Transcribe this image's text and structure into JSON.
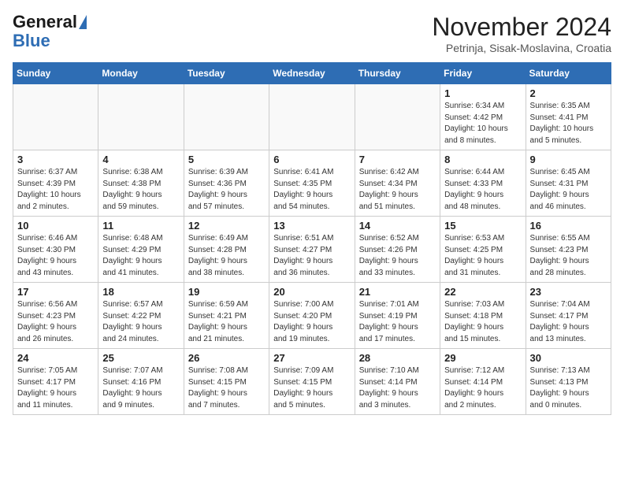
{
  "header": {
    "logo_line1": "General",
    "logo_line2": "Blue",
    "month": "November 2024",
    "location": "Petrinja, Sisak-Moslavina, Croatia"
  },
  "weekdays": [
    "Sunday",
    "Monday",
    "Tuesday",
    "Wednesday",
    "Thursday",
    "Friday",
    "Saturday"
  ],
  "weeks": [
    [
      {
        "day": "",
        "info": ""
      },
      {
        "day": "",
        "info": ""
      },
      {
        "day": "",
        "info": ""
      },
      {
        "day": "",
        "info": ""
      },
      {
        "day": "",
        "info": ""
      },
      {
        "day": "1",
        "info": "Sunrise: 6:34 AM\nSunset: 4:42 PM\nDaylight: 10 hours\nand 8 minutes."
      },
      {
        "day": "2",
        "info": "Sunrise: 6:35 AM\nSunset: 4:41 PM\nDaylight: 10 hours\nand 5 minutes."
      }
    ],
    [
      {
        "day": "3",
        "info": "Sunrise: 6:37 AM\nSunset: 4:39 PM\nDaylight: 10 hours\nand 2 minutes."
      },
      {
        "day": "4",
        "info": "Sunrise: 6:38 AM\nSunset: 4:38 PM\nDaylight: 9 hours\nand 59 minutes."
      },
      {
        "day": "5",
        "info": "Sunrise: 6:39 AM\nSunset: 4:36 PM\nDaylight: 9 hours\nand 57 minutes."
      },
      {
        "day": "6",
        "info": "Sunrise: 6:41 AM\nSunset: 4:35 PM\nDaylight: 9 hours\nand 54 minutes."
      },
      {
        "day": "7",
        "info": "Sunrise: 6:42 AM\nSunset: 4:34 PM\nDaylight: 9 hours\nand 51 minutes."
      },
      {
        "day": "8",
        "info": "Sunrise: 6:44 AM\nSunset: 4:33 PM\nDaylight: 9 hours\nand 48 minutes."
      },
      {
        "day": "9",
        "info": "Sunrise: 6:45 AM\nSunset: 4:31 PM\nDaylight: 9 hours\nand 46 minutes."
      }
    ],
    [
      {
        "day": "10",
        "info": "Sunrise: 6:46 AM\nSunset: 4:30 PM\nDaylight: 9 hours\nand 43 minutes."
      },
      {
        "day": "11",
        "info": "Sunrise: 6:48 AM\nSunset: 4:29 PM\nDaylight: 9 hours\nand 41 minutes."
      },
      {
        "day": "12",
        "info": "Sunrise: 6:49 AM\nSunset: 4:28 PM\nDaylight: 9 hours\nand 38 minutes."
      },
      {
        "day": "13",
        "info": "Sunrise: 6:51 AM\nSunset: 4:27 PM\nDaylight: 9 hours\nand 36 minutes."
      },
      {
        "day": "14",
        "info": "Sunrise: 6:52 AM\nSunset: 4:26 PM\nDaylight: 9 hours\nand 33 minutes."
      },
      {
        "day": "15",
        "info": "Sunrise: 6:53 AM\nSunset: 4:25 PM\nDaylight: 9 hours\nand 31 minutes."
      },
      {
        "day": "16",
        "info": "Sunrise: 6:55 AM\nSunset: 4:23 PM\nDaylight: 9 hours\nand 28 minutes."
      }
    ],
    [
      {
        "day": "17",
        "info": "Sunrise: 6:56 AM\nSunset: 4:23 PM\nDaylight: 9 hours\nand 26 minutes."
      },
      {
        "day": "18",
        "info": "Sunrise: 6:57 AM\nSunset: 4:22 PM\nDaylight: 9 hours\nand 24 minutes."
      },
      {
        "day": "19",
        "info": "Sunrise: 6:59 AM\nSunset: 4:21 PM\nDaylight: 9 hours\nand 21 minutes."
      },
      {
        "day": "20",
        "info": "Sunrise: 7:00 AM\nSunset: 4:20 PM\nDaylight: 9 hours\nand 19 minutes."
      },
      {
        "day": "21",
        "info": "Sunrise: 7:01 AM\nSunset: 4:19 PM\nDaylight: 9 hours\nand 17 minutes."
      },
      {
        "day": "22",
        "info": "Sunrise: 7:03 AM\nSunset: 4:18 PM\nDaylight: 9 hours\nand 15 minutes."
      },
      {
        "day": "23",
        "info": "Sunrise: 7:04 AM\nSunset: 4:17 PM\nDaylight: 9 hours\nand 13 minutes."
      }
    ],
    [
      {
        "day": "24",
        "info": "Sunrise: 7:05 AM\nSunset: 4:17 PM\nDaylight: 9 hours\nand 11 minutes."
      },
      {
        "day": "25",
        "info": "Sunrise: 7:07 AM\nSunset: 4:16 PM\nDaylight: 9 hours\nand 9 minutes."
      },
      {
        "day": "26",
        "info": "Sunrise: 7:08 AM\nSunset: 4:15 PM\nDaylight: 9 hours\nand 7 minutes."
      },
      {
        "day": "27",
        "info": "Sunrise: 7:09 AM\nSunset: 4:15 PM\nDaylight: 9 hours\nand 5 minutes."
      },
      {
        "day": "28",
        "info": "Sunrise: 7:10 AM\nSunset: 4:14 PM\nDaylight: 9 hours\nand 3 minutes."
      },
      {
        "day": "29",
        "info": "Sunrise: 7:12 AM\nSunset: 4:14 PM\nDaylight: 9 hours\nand 2 minutes."
      },
      {
        "day": "30",
        "info": "Sunrise: 7:13 AM\nSunset: 4:13 PM\nDaylight: 9 hours\nand 0 minutes."
      }
    ]
  ]
}
